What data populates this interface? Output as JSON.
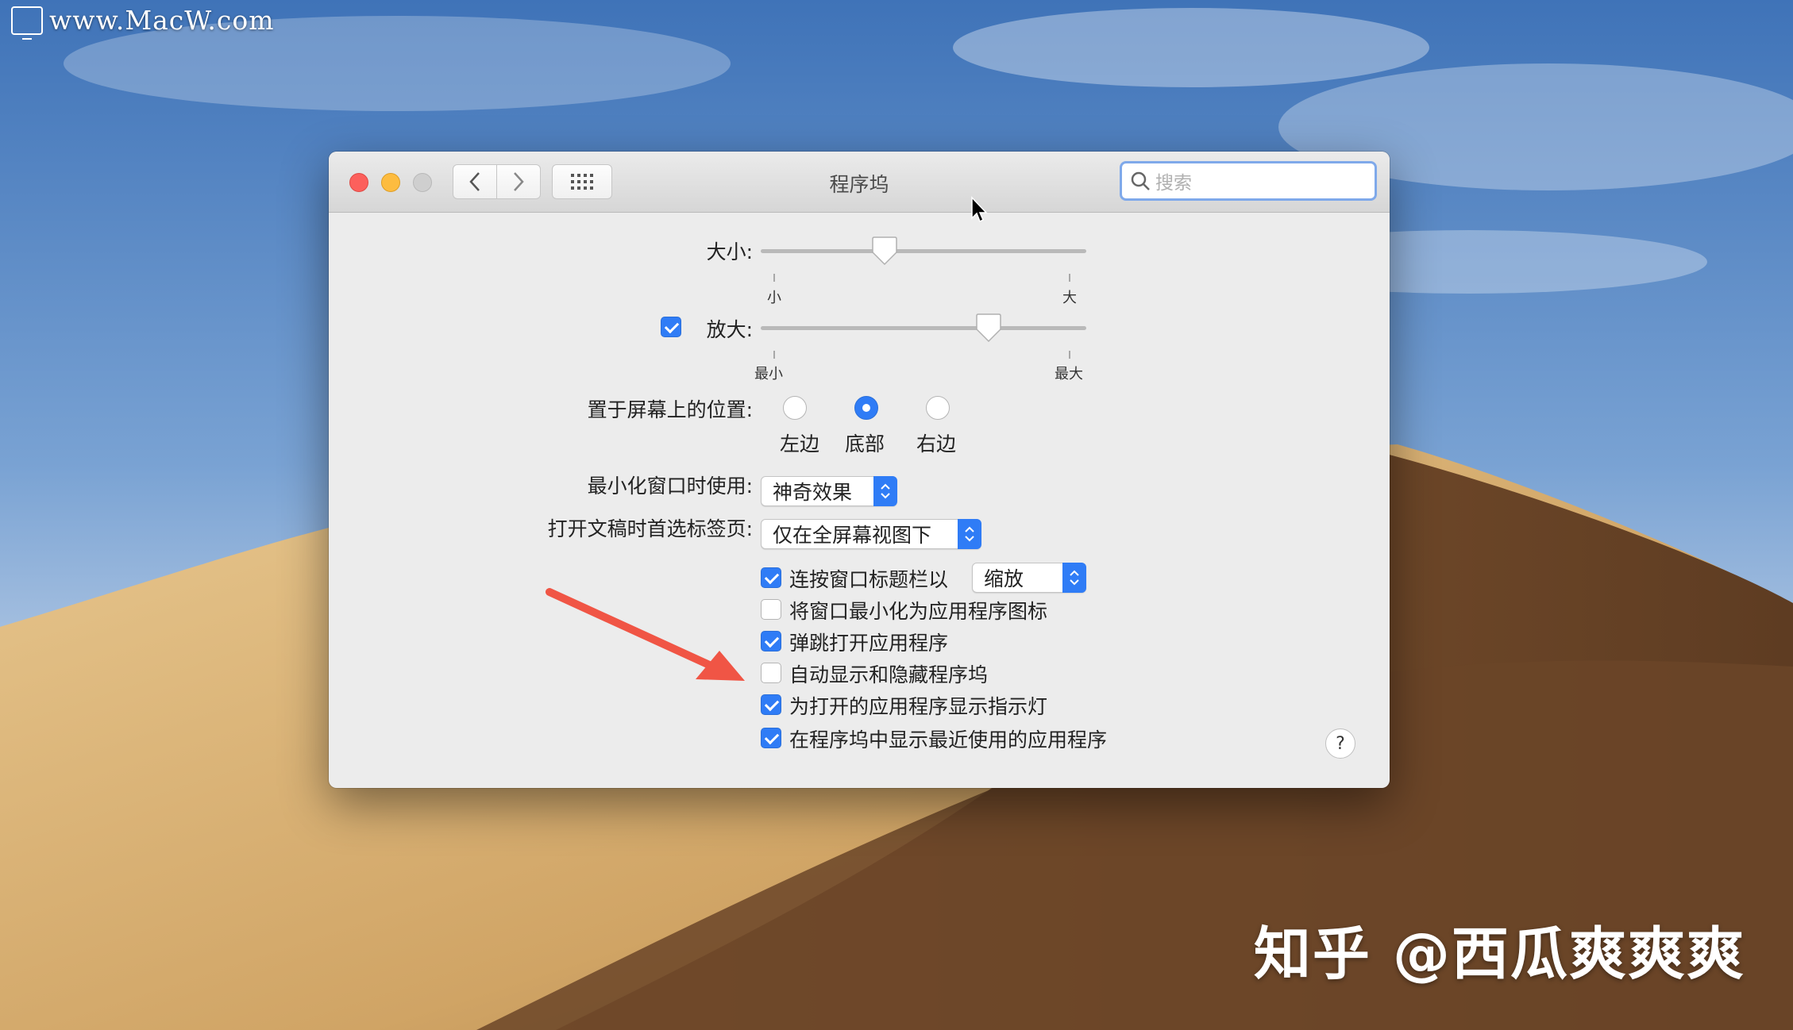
{
  "watermark": {
    "site": "www.MacW.com",
    "author": "知乎 @西瓜爽爽爽"
  },
  "window": {
    "title": "程序坞",
    "search_placeholder": "搜索"
  },
  "size": {
    "label": "大小:",
    "min_label": "小",
    "max_label": "大",
    "value_fraction": 0.38
  },
  "magnification": {
    "checked": true,
    "label": "放大:",
    "min_label": "最小",
    "max_label": "最大",
    "value_fraction": 0.7
  },
  "position": {
    "label": "置于屏幕上的位置:",
    "options": [
      {
        "label": "左边",
        "selected": false
      },
      {
        "label": "底部",
        "selected": true
      },
      {
        "label": "右边",
        "selected": false
      }
    ]
  },
  "minimize_effect": {
    "label": "最小化窗口时使用:",
    "value": "神奇效果"
  },
  "prefer_tabs": {
    "label": "打开文稿时首选标签页:",
    "value": "仅在全屏幕视图下"
  },
  "options": {
    "double_click": {
      "label": "连按窗口标题栏以",
      "checked": true,
      "value": "缩放"
    },
    "minimize_into_icon": {
      "label": "将窗口最小化为应用程序图标",
      "checked": false
    },
    "animate_opening": {
      "label": "弹跳打开应用程序",
      "checked": true
    },
    "autohide": {
      "label": "自动显示和隐藏程序坞",
      "checked": false
    },
    "show_indicators": {
      "label": "为打开的应用程序显示指示灯",
      "checked": true
    },
    "show_recent": {
      "label": "在程序坞中显示最近使用的应用程序",
      "checked": true
    }
  },
  "help": {
    "label": "?"
  },
  "colors": {
    "accent": "#2f7cf6",
    "close": "#fc605c",
    "minimize": "#fdbc40",
    "annotation_arrow": "#f05545"
  },
  "icons": [
    "chevron-left-icon",
    "chevron-right-icon",
    "grid-icon",
    "search-icon",
    "cursor-icon",
    "arrow-annotation-icon"
  ]
}
